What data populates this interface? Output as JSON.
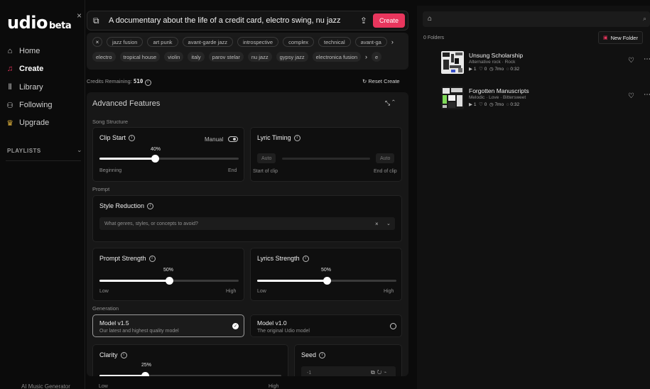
{
  "sidebar": {
    "logo": "udio",
    "logo_suffix": "beta",
    "close_glyph": "×",
    "items": [
      {
        "label": "Home",
        "icon": "home-icon",
        "glyph": "⌂"
      },
      {
        "label": "Create",
        "icon": "create-icon",
        "glyph": "♫"
      },
      {
        "label": "Library",
        "icon": "library-icon",
        "glyph": "⫴"
      },
      {
        "label": "Following",
        "icon": "user-icon",
        "glyph": "⚇"
      },
      {
        "label": "Upgrade",
        "icon": "crown-icon",
        "glyph": "♛"
      }
    ],
    "playlists_label": "PLAYLISTS",
    "footer": "AI Music Generator"
  },
  "prompt": {
    "text": "A documentary about the life of a credit card, electro swing, nu jazz",
    "create_label": "Create"
  },
  "tags": {
    "row1": [
      "jazz fusion",
      "art punk",
      "avant-garde jazz",
      "introspective",
      "complex",
      "technical",
      "avant-ga"
    ],
    "row2": [
      "electro",
      "tropical house",
      "violin",
      "italy",
      "parov stelar",
      "nu jazz",
      "gypsy jazz",
      "electronica fusion"
    ],
    "row2_trailing": "e"
  },
  "credits": {
    "label": "Credits Remaining:",
    "value": "510"
  },
  "reset_label": "Reset Create",
  "advanced": {
    "title": "Advanced Features",
    "song_structure_label": "Song Structure",
    "clip_start": {
      "title": "Clip Start",
      "manual_label": "Manual",
      "value_label": "40%",
      "value": 0.4,
      "low": "Beginning",
      "high": "End"
    },
    "lyric_timing": {
      "title": "Lyric Timing",
      "auto_left": "Auto",
      "auto_right": "Auto",
      "low": "Start of clip",
      "high": "End of clip"
    },
    "prompt_label": "Prompt",
    "style_reduction": {
      "title": "Style Reduction",
      "placeholder": "What genres, styles, or concepts to avoid?",
      "clear_glyph": "×",
      "dropdown_glyph": "⌄"
    },
    "prompt_strength": {
      "title": "Prompt Strength",
      "value_label": "50%",
      "value": 0.5,
      "low": "Low",
      "high": "High"
    },
    "lyrics_strength": {
      "title": "Lyrics Strength",
      "value_label": "50%",
      "value": 0.5,
      "low": "Low",
      "high": "High"
    },
    "generation_label": "Generation",
    "model_a": {
      "title": "Model v1.5",
      "desc": "Our latest and highest quality model",
      "selected": true
    },
    "model_b": {
      "title": "Model v1.0",
      "desc": "The original Udio model",
      "selected": false
    },
    "clarity": {
      "title": "Clarity",
      "value_label": "25%",
      "value": 0.25,
      "low": "Low",
      "high": "High"
    },
    "seed": {
      "title": "Seed",
      "value": "-1"
    }
  },
  "right_panel": {
    "folders_label": "0 Folders",
    "new_folder_label": "New Folder",
    "songs": [
      {
        "title": "Unsung Scholarship",
        "tags": "Alternative rock · Rock",
        "plays": "1",
        "likes": "0",
        "age": "7mo",
        "duration": "0:32"
      },
      {
        "title": "Forgotten Manuscripts",
        "tags": "Melodic · Love · Bittersweet",
        "plays": "1",
        "likes": "0",
        "age": "7mo",
        "duration": "0:32"
      }
    ]
  },
  "colors": {
    "accent": "#e8365d",
    "panel": "#171717",
    "card": "#0f0f0f"
  }
}
